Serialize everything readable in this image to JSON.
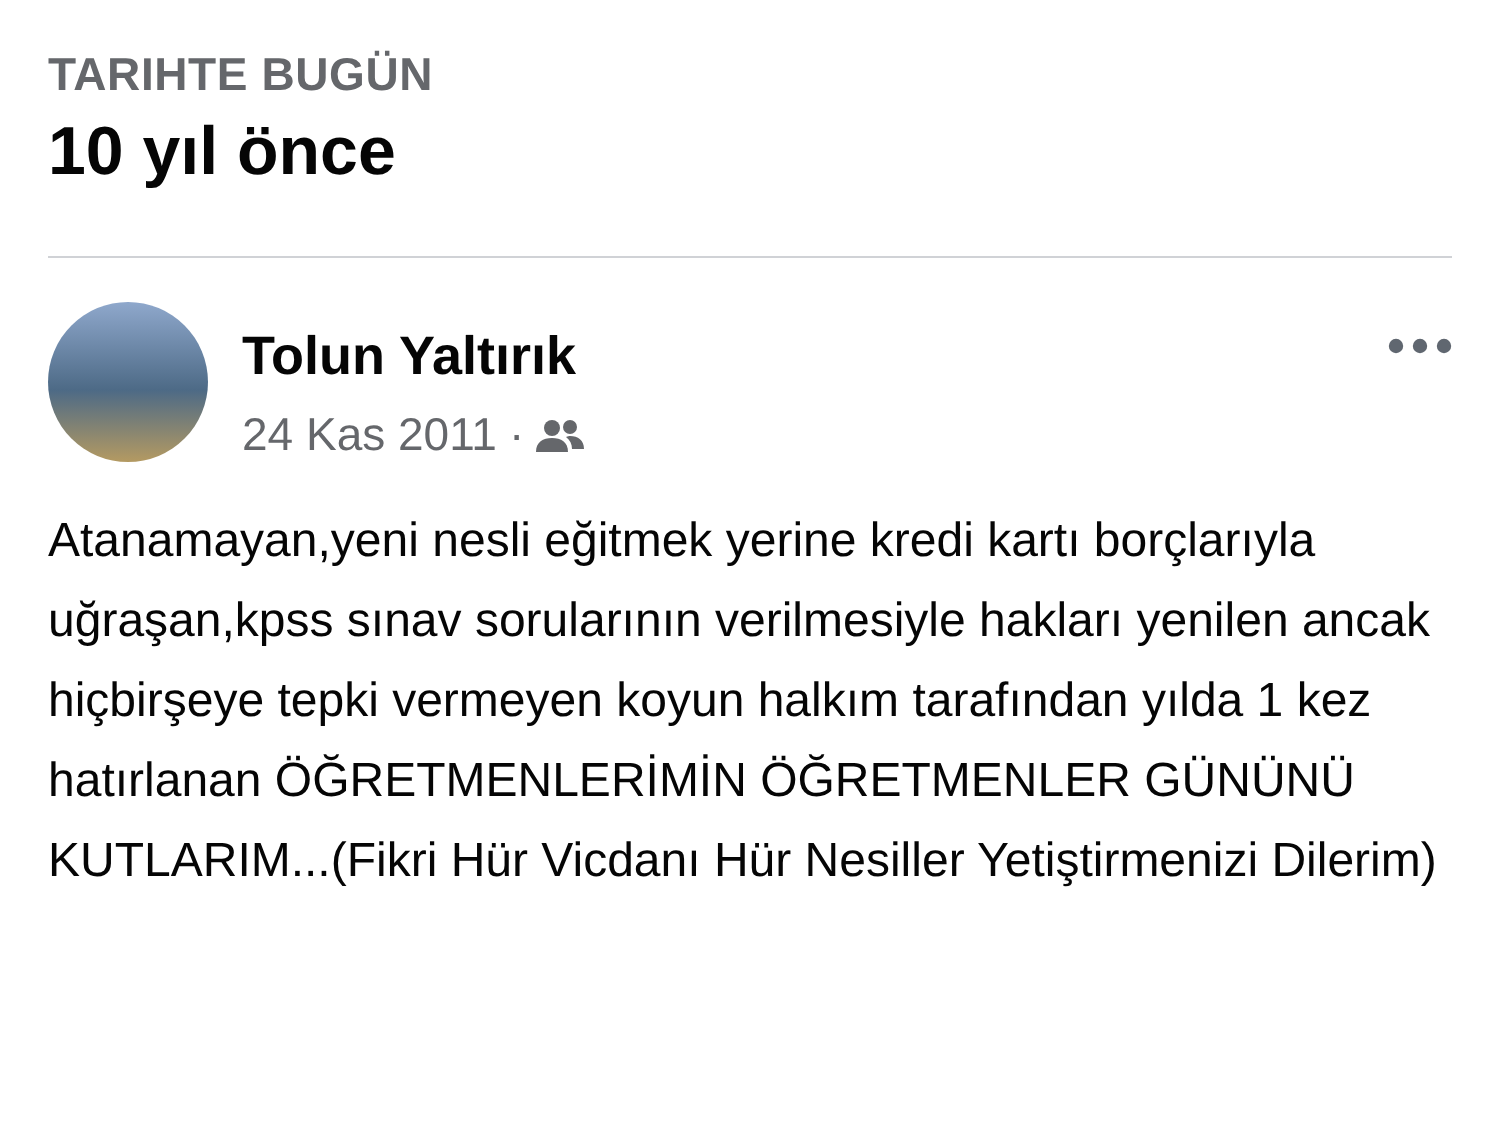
{
  "header": {
    "section": "TARIHTE BUGÜN",
    "title": "10 yıl önce"
  },
  "post": {
    "author": "Tolun Yaltırık",
    "date": "24 Kas 2011",
    "separator": "·",
    "text": "Atanamayan,yeni nesli eğitmek yerine kredi kartı borçlarıyla uğraşan,kpss sınav sorularının verilmesiyle hakları yenilen ancak hiçbirşeye tepki vermeyen koyun halkım tarafından yılda 1 kez hatırlanan ÖĞRETMENLERİMİN ÖĞRETMENLER GÜNÜNÜ KUTLARIM...(Fikri Hür Vicdanı Hür Nesiller Yetiştirmenizi Dilerim)"
  }
}
